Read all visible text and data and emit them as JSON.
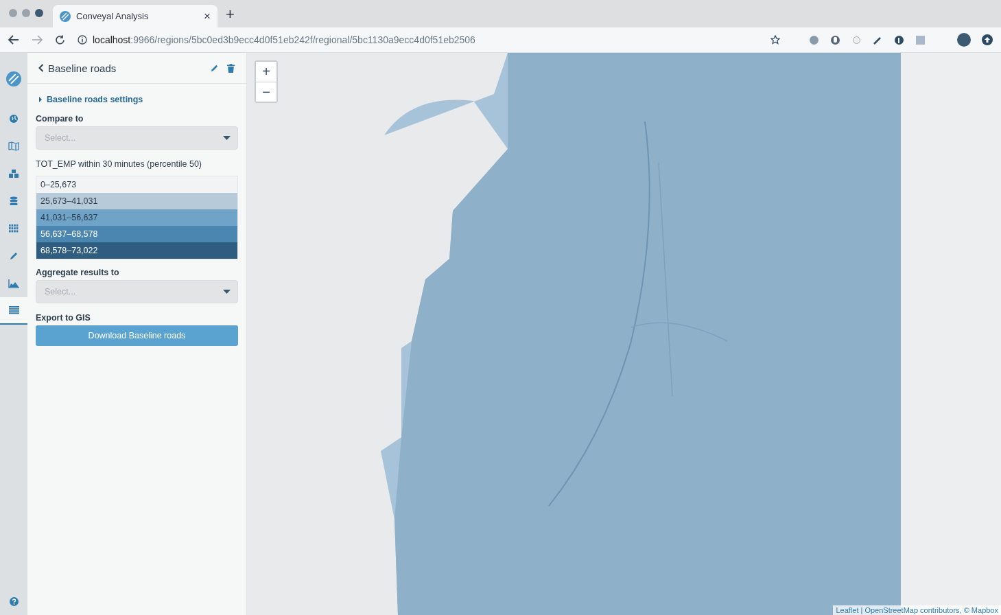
{
  "browser": {
    "tab_title": "Conveyal Analysis",
    "tab_close": "×",
    "new_tab": "+",
    "url_host": "localhost",
    "url_path": ":9966/regions/5bc0ed3b9ecc4d0f51eb242f/regional/5bc1130a9ecc4d0f51eb2506"
  },
  "nav": {
    "items": [
      {
        "kind": "globe",
        "selected": false
      },
      {
        "kind": "map",
        "selected": false
      },
      {
        "kind": "cubes",
        "selected": false
      },
      {
        "kind": "database",
        "selected": false
      },
      {
        "kind": "grid",
        "selected": false
      },
      {
        "kind": "pencil",
        "selected": false
      },
      {
        "kind": "chart",
        "selected": false
      },
      {
        "kind": "list",
        "selected": true
      }
    ]
  },
  "panel": {
    "title": "Baseline roads",
    "settings_label": "Baseline roads settings",
    "settings_expanded": false,
    "compare_label": "Compare to",
    "compare_placeholder": "Select...",
    "legend_title": "TOT_EMP within 30 minutes (percentile 50)",
    "legend": [
      {
        "label": "0–25,673",
        "color": "#f1f3f5"
      },
      {
        "label": "25,673–41,031",
        "color": "#b7cad9"
      },
      {
        "label": "41,031–56,637",
        "color": "#6fa3c7"
      },
      {
        "label": "56,637–68,578",
        "color": "#4a86b0"
      },
      {
        "label": "68,578–73,022",
        "color": "#2f5d80"
      }
    ],
    "aggregate_label": "Aggregate results to",
    "aggregate_placeholder": "Select...",
    "export_label": "Export to GIS",
    "download_button": "Download Baseline roads"
  },
  "map": {
    "zoom_in": "+",
    "zoom_out": "−",
    "attribution": "Leaflet | OpenStreetMap contributors, © Mapbox"
  }
}
